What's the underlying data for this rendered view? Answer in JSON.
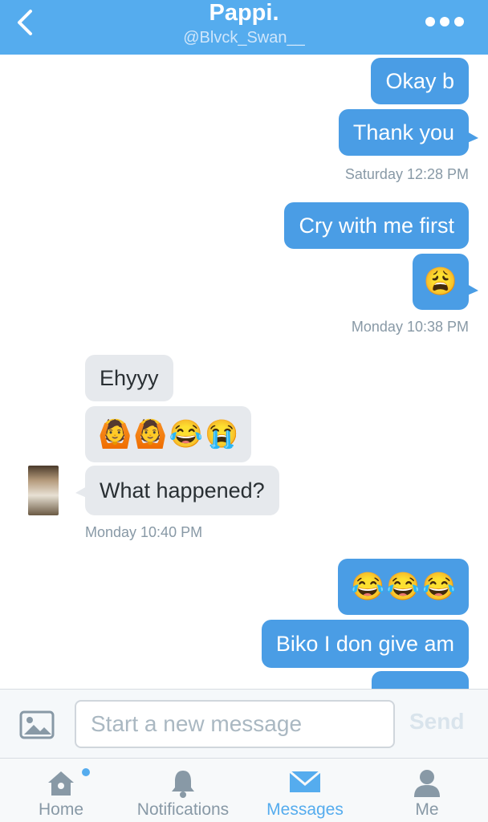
{
  "header": {
    "title": "Pappi.",
    "handle": "@Blvck_Swan__",
    "back_icon": "chevron-left-icon",
    "more_icon": "more-dots-icon"
  },
  "messages": {
    "m1": "Okay b",
    "m2": "Thank you",
    "ts1": "Saturday 12:28 PM",
    "m3": "Cry with me first",
    "m4_emoji": [
      "😩"
    ],
    "ts2": "Monday 10:38 PM",
    "m5": "Ehyyy",
    "m6_emoji": [
      "🙆",
      "🙆",
      "😂",
      "😭"
    ],
    "m7": "What happened?",
    "ts3": "Monday 10:40 PM",
    "m8_emoji": [
      "😂",
      "😂",
      "😂"
    ],
    "m9": "Biko I don give am",
    "m10_emoji": [
      "😂",
      "😂"
    ]
  },
  "composer": {
    "placeholder": "Start a new message",
    "send_label": "Send",
    "image_icon": "image-icon"
  },
  "tabs": [
    {
      "label": "Home",
      "icon": "home-icon",
      "active": false,
      "has_dot": true
    },
    {
      "label": "Notifications",
      "icon": "bell-icon",
      "active": false
    },
    {
      "label": "Messages",
      "icon": "envelope-icon",
      "active": true
    },
    {
      "label": "Me",
      "icon": "person-icon",
      "active": false
    }
  ],
  "colors": {
    "header_bg": "#55acee",
    "outgoing_bubble": "#4a9de5",
    "incoming_bubble": "#e6e9ed",
    "active_tab": "#55acee",
    "inactive_tab": "#8899a6"
  }
}
